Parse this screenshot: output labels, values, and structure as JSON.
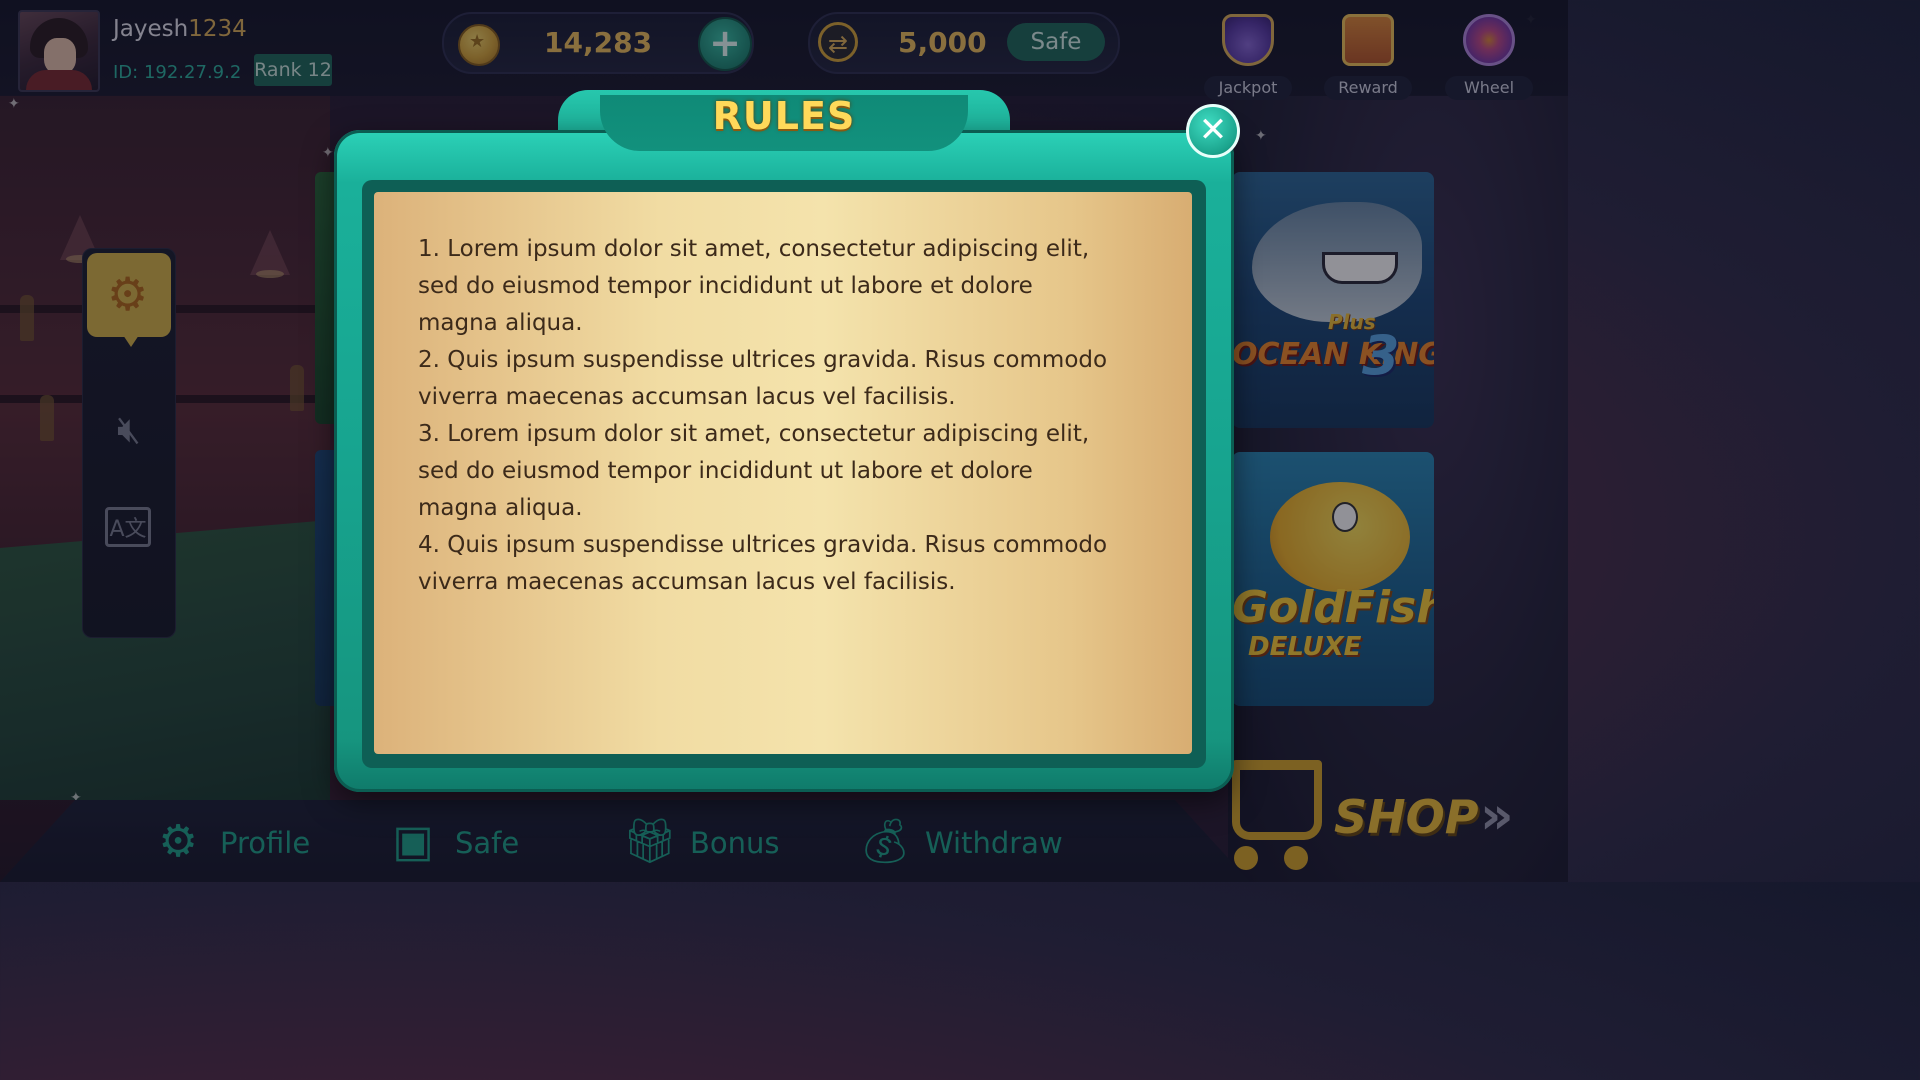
{
  "user": {
    "name_prefix": "Jayesh",
    "name_suffix": "1234",
    "id_text": "ID: 192.27.9.2",
    "rank": "Rank 12"
  },
  "currency": {
    "coins": "14,283",
    "add_symbol": "+",
    "safe_amount": "5,000",
    "safe_label": "Safe"
  },
  "top_icons": [
    {
      "label": "Jackpot",
      "icon": "jackpot-chest-icon"
    },
    {
      "label": "Reward",
      "icon": "treasure-chest-icon"
    },
    {
      "label": "Wheel",
      "icon": "wheel-icon"
    }
  ],
  "side_panel": {
    "settings_icon": "gear-icon",
    "sound_icon": "speaker-muted-icon",
    "language_icon": "translate-icon",
    "language_glyph": "A文"
  },
  "games": [
    {
      "title_line1": "Plus",
      "title_line2": "OCEAN KING",
      "title_num": "3"
    },
    {
      "title": "GoldFish",
      "subtitle": "DELUXE"
    }
  ],
  "modal": {
    "title": "RULES",
    "close_symbol": "✕",
    "lines": [
      "1. Lorem ipsum dolor sit amet, consectetur adipiscing elit,",
      "sed do eiusmod tempor incididunt ut labore et dolore",
      "magna aliqua.",
      "2. Quis ipsum suspendisse ultrices gravida. Risus commodo",
      "viverra maecenas accumsan lacus vel facilisis.",
      "3. Lorem ipsum dolor sit amet, consectetur adipiscing elit,",
      "sed do eiusmod tempor incididunt ut labore et dolore",
      "magna aliqua.",
      "4. Quis ipsum suspendisse ultrices gravida. Risus commodo",
      "viverra maecenas accumsan lacus vel facilisis."
    ]
  },
  "bottom_nav": [
    {
      "label": "Profile",
      "icon": "profile-gear-icon"
    },
    {
      "label": "Safe",
      "icon": "safe-icon"
    },
    {
      "label": "Bonus",
      "icon": "gift-icon"
    },
    {
      "label": "Withdraw",
      "icon": "money-bag-icon"
    }
  ],
  "shop": {
    "label": "SHOP",
    "arrows": "»"
  },
  "colors": {
    "accent_teal": "#1ab09a",
    "gold": "#f0c25e",
    "nav_teal": "#1fa58a"
  }
}
